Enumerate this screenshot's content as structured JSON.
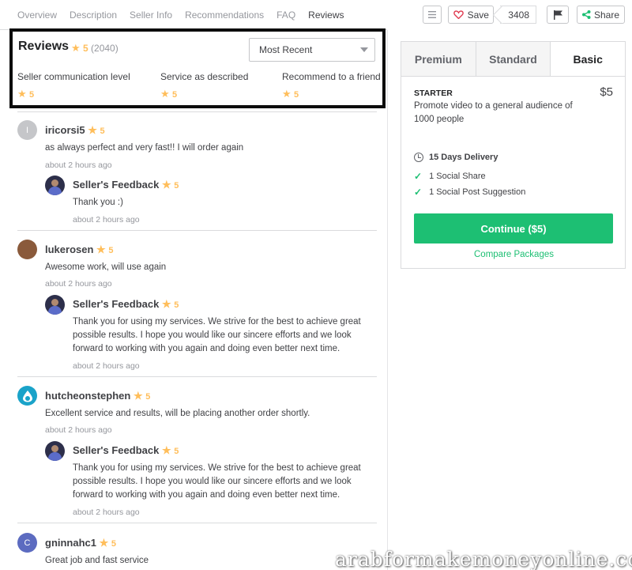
{
  "nav": {
    "tabs": [
      "Overview",
      "Description",
      "Seller Info",
      "Recommendations",
      "FAQ",
      "Reviews"
    ],
    "active_index": 5,
    "save_label": "Save",
    "save_count": "3408",
    "share_label": "Share"
  },
  "reviews_header": {
    "title": "Reviews",
    "rating": "5",
    "count": "(2040)",
    "sort_selected": "Most Recent",
    "criteria": [
      {
        "label": "Seller communication level",
        "rating": "5"
      },
      {
        "label": "Service as described",
        "rating": "5"
      },
      {
        "label": "Recommend to a friend",
        "rating": "5"
      }
    ]
  },
  "reviews": [
    {
      "avatar_letter": "I",
      "avatar_color": "#c5c6c9",
      "username": "iricorsi5",
      "rating": "5",
      "text": "as always perfect and very fast!! I will order again",
      "time": "about 2 hours ago",
      "seller_label": "Seller's Feedback",
      "seller_rating": "5",
      "seller_text": "Thank you :)",
      "seller_time": "about 2 hours ago"
    },
    {
      "avatar_letter": "",
      "avatar_color": "#8a5a3b",
      "username": "lukerosen",
      "rating": "5",
      "text": "Awesome work, will use again",
      "time": "about 2 hours ago",
      "seller_label": "Seller's Feedback",
      "seller_rating": "5",
      "seller_text": "Thank you for using my services. We strive for the best to achieve great possible results. I hope you would like our sincere efforts and we look forward to working with you again and doing even better next time.",
      "seller_time": "about 2 hours ago"
    },
    {
      "avatar_letter": "",
      "avatar_color": "#1aa3c9",
      "username": "hutcheonstephen",
      "rating": "5",
      "text": "Excellent service and results, will be placing another order shortly.",
      "time": "about 2 hours ago",
      "seller_label": "Seller's Feedback",
      "seller_rating": "5",
      "seller_text": "Thank you for using my services. We strive for the best to achieve great possible results. I hope you would like our sincere efforts and we look forward to working with you again and doing even better next time.",
      "seller_time": "about 2 hours ago"
    },
    {
      "avatar_letter": "C",
      "avatar_color": "#5c6bc0",
      "username": "gninnahc1",
      "rating": "5",
      "text": "Great job and fast service"
    }
  ],
  "package": {
    "tabs": [
      "Premium",
      "Standard",
      "Basic"
    ],
    "active_tab": "Basic",
    "name": "STARTER",
    "price": "$5",
    "description": "Promote video to a general audience of 1000 people",
    "delivery": "15 Days Delivery",
    "features": [
      "1 Social Share",
      "1 Social Post Suggestion"
    ],
    "continue_label": "Continue ($5)",
    "compare_label": "Compare Packages"
  },
  "watermark": "arabformakemoneyonline.com",
  "colors": {
    "accent": "#1dbf73",
    "star": "#ffbe5b",
    "highlight_border": "#0c0c0c"
  }
}
